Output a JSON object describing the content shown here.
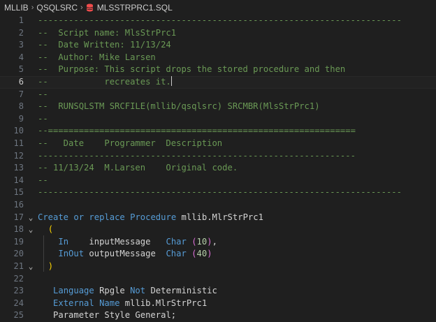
{
  "breadcrumb": {
    "segments": [
      "MLLIB",
      "QSQLSRC",
      "MLSSTRPRC1.SQL"
    ],
    "file_icon": "database-icon",
    "file_icon_color": "#f14c4c"
  },
  "editor": {
    "current_line": 6,
    "lines": [
      {
        "n": "1"
      },
      {
        "n": "2"
      },
      {
        "n": "3"
      },
      {
        "n": "4"
      },
      {
        "n": "5"
      },
      {
        "n": "6"
      },
      {
        "n": "7"
      },
      {
        "n": "8"
      },
      {
        "n": "9"
      },
      {
        "n": "10"
      },
      {
        "n": "11"
      },
      {
        "n": "12"
      },
      {
        "n": "13"
      },
      {
        "n": "14"
      },
      {
        "n": "15"
      },
      {
        "n": "16"
      },
      {
        "n": "17"
      },
      {
        "n": "18"
      },
      {
        "n": "19"
      },
      {
        "n": "20"
      },
      {
        "n": "21"
      },
      {
        "n": "22"
      },
      {
        "n": "23"
      },
      {
        "n": "24"
      },
      {
        "n": "25"
      }
    ],
    "code": {
      "l1": "-----------------------------------------------------------------------",
      "l2": "--  Script name: MlsStrPrc1",
      "l3": "--  Date Written: 11/13/24",
      "l4": "--  Author: Mike Larsen",
      "l5": "--  Purpose: This script drops the stored procedure and then",
      "l6": "--           recreates it.",
      "l7": "--",
      "l8": "--  RUNSQLSTM SRCFILE(mllib/qsqlsrc) SRCMBR(MlsStrPrc1)",
      "l9": "--",
      "l10": "--============================================================",
      "l11": "--   Date    Programmer  Description",
      "l12": "--------------------------------------------------------------",
      "l13": "-- 11/13/24  M.Larsen    Original code.",
      "l14": "--",
      "l15": "-----------------------------------------------------------------------",
      "l17_kw1": "Create",
      "l17_kw2": "or",
      "l17_kw3": "replace",
      "l17_kw4": "Procedure",
      "l17_name": "mllib.MlrStrPrc1",
      "l18_paren": "(",
      "l19_mode": "In",
      "l19_param": "inputMessage",
      "l19_type": "Char",
      "l19_num": "10",
      "l20_mode": "InOut",
      "l20_param": "outputMessage",
      "l20_type": "Char",
      "l20_num": "40",
      "l21_paren": ")",
      "l23_kw1": "Language",
      "l23_val": "Rpgle",
      "l23_kw2": "Not",
      "l23_val2": "Deterministic",
      "l24_kw1": "External",
      "l24_kw2": "Name",
      "l24_val": "mllib.MlrStrPrc1",
      "l25_text": "Parameter Style General;"
    },
    "fold_icon": "chevron-down-icon"
  }
}
